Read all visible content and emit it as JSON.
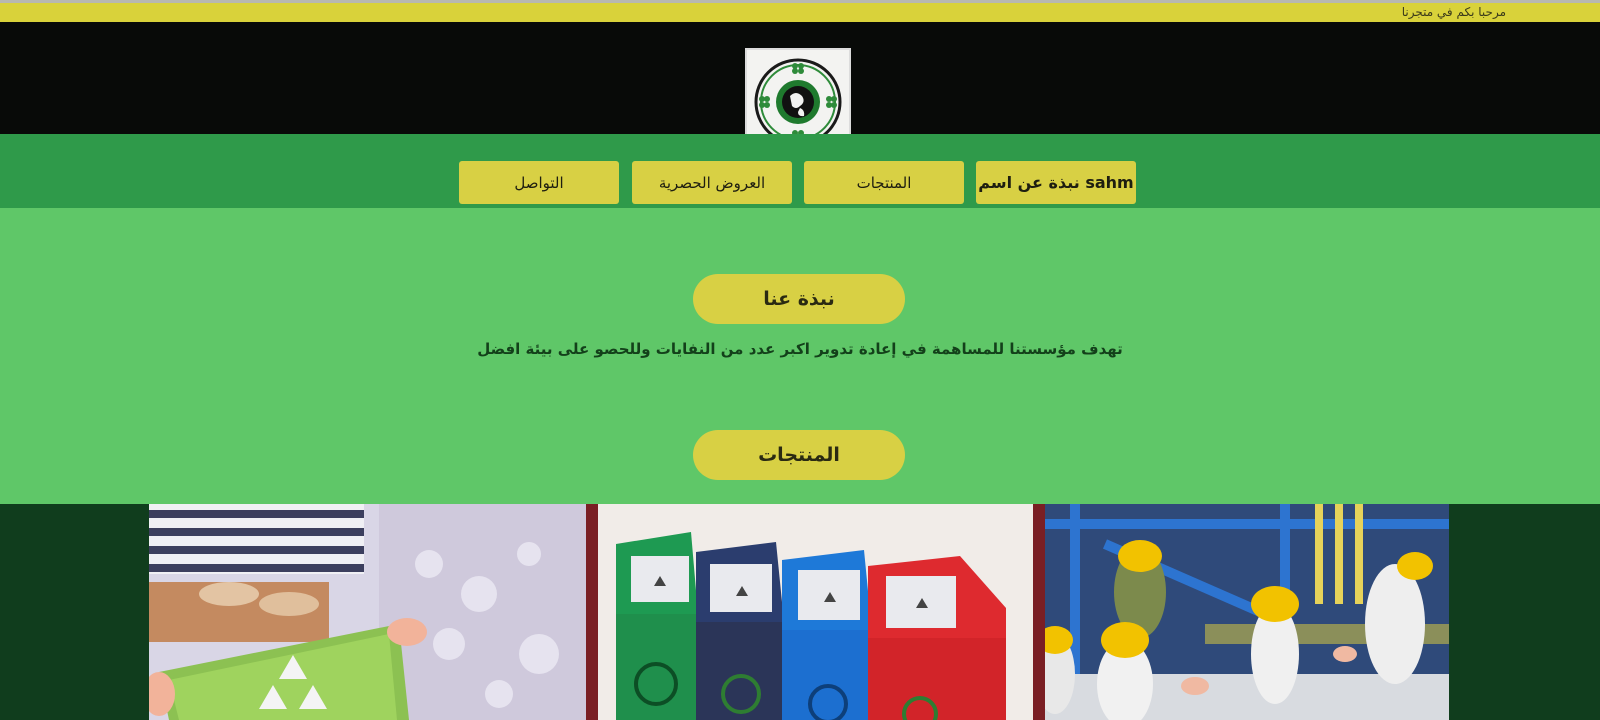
{
  "topbar": {
    "welcome": "مرحبا بكم في متجرنا"
  },
  "nav": {
    "items": [
      {
        "label": "sahm نبذة عن اسم"
      },
      {
        "label": "المنتجات"
      },
      {
        "label": "العروض الحصرية"
      },
      {
        "label": "التواصل"
      }
    ]
  },
  "about": {
    "heading": "نبذة عنا",
    "text": "تهدف مؤسستنا للمساهمة في إعادة تدوير اكبر عدد من النفايات وللحصو على بيئة افضل"
  },
  "products": {
    "heading": "المنتجات"
  },
  "gallery": {
    "images": [
      {
        "name": "recycling-basket-photo"
      },
      {
        "name": "recycling-bins-photo"
      },
      {
        "name": "sorting-workers-photo"
      }
    ]
  },
  "colors": {
    "yellow": "#d8d044",
    "dark_green": "#2f9a4a",
    "light_green": "#5fc768",
    "black": "#080a08"
  }
}
